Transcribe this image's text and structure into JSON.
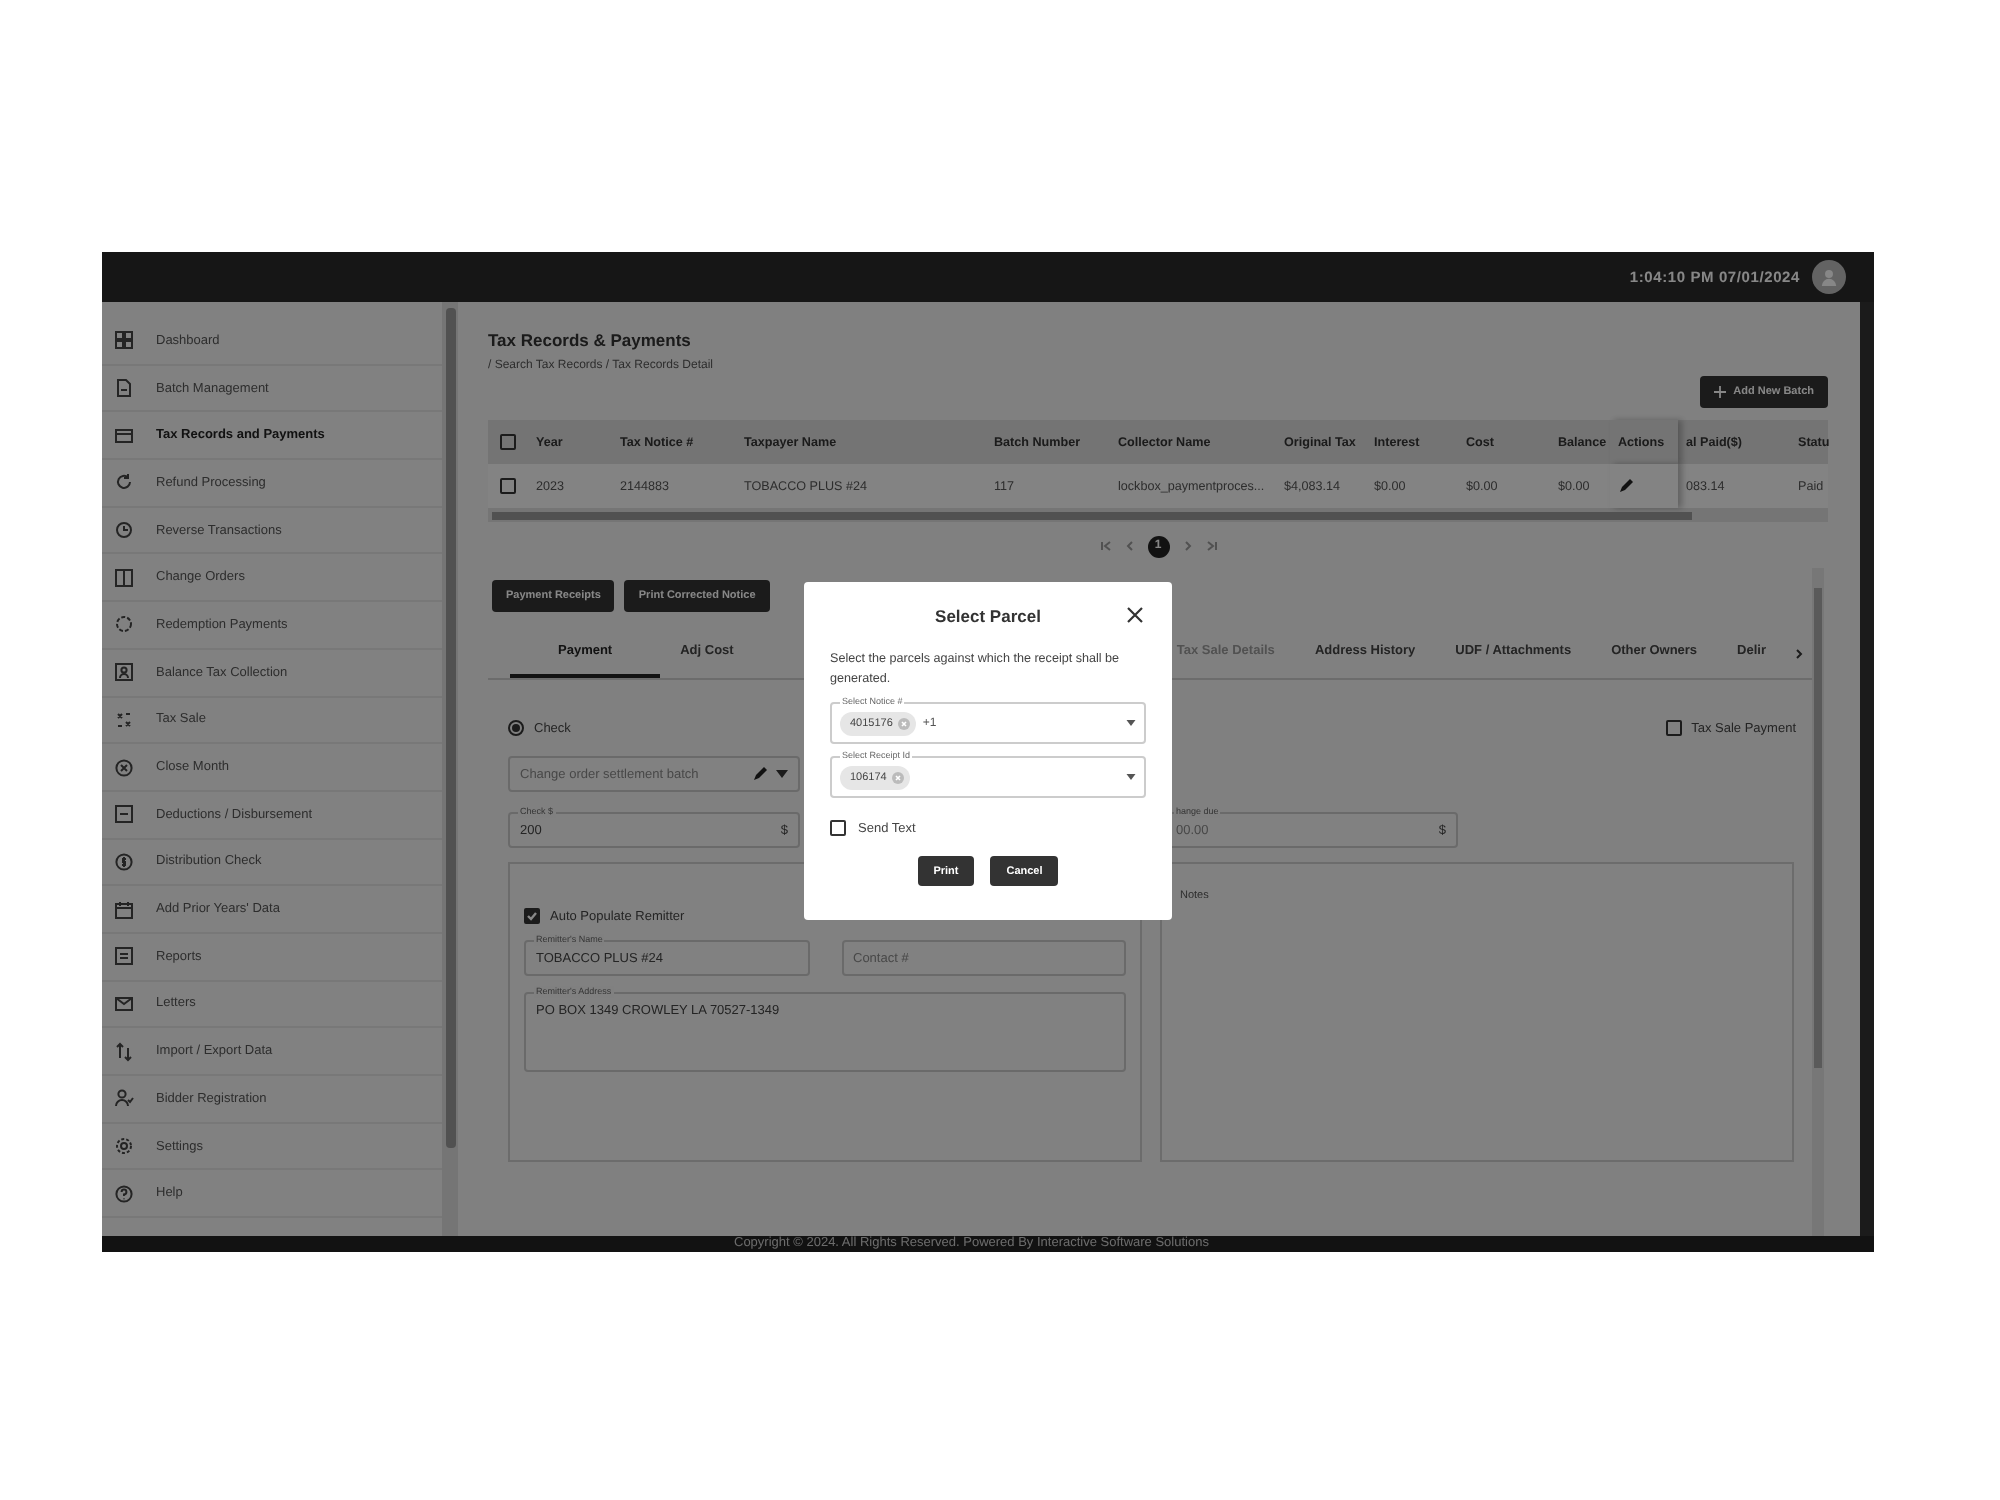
{
  "topbar": {
    "time": "1:04:10 PM 07/01/2024"
  },
  "sidebar": {
    "items": [
      {
        "label": "Dashboard",
        "selected": false
      },
      {
        "label": "Batch Management",
        "selected": false
      },
      {
        "label": "Tax Records and Payments",
        "selected": true
      },
      {
        "label": "Refund Processing",
        "selected": false
      },
      {
        "label": "Reverse Transactions",
        "selected": false
      },
      {
        "label": "Change Orders",
        "selected": false
      },
      {
        "label": "Redemption Payments",
        "selected": false
      },
      {
        "label": "Balance Tax Collection",
        "selected": false
      },
      {
        "label": "Tax Sale",
        "selected": false
      },
      {
        "label": "Close Month",
        "selected": false
      },
      {
        "label": "Deductions / Disbursement",
        "selected": false
      },
      {
        "label": "Distribution Check",
        "selected": false
      },
      {
        "label": "Add Prior Years' Data",
        "selected": false
      },
      {
        "label": "Reports",
        "selected": false
      },
      {
        "label": "Letters",
        "selected": false
      },
      {
        "label": "Import / Export Data",
        "selected": false
      },
      {
        "label": "Bidder Registration",
        "selected": false
      },
      {
        "label": "Settings",
        "selected": false
      },
      {
        "label": "Help",
        "selected": false
      }
    ]
  },
  "page": {
    "title": "Tax Records & Payments",
    "breadcrumb": "/ Search Tax Records / Tax Records Detail",
    "add_button": "Add New Batch"
  },
  "table": {
    "all_checked": false,
    "columns": [
      "Year",
      "Tax Notice #",
      "Taxpayer Name",
      "Batch Number",
      "Collector Name",
      "Original Tax",
      "Interest",
      "Cost",
      "Balance",
      "Actions",
      "al Paid($)",
      "Statu"
    ],
    "rows": [
      {
        "checked": false,
        "cells": [
          "2023",
          "2144883",
          "TOBACCO PLUS #24",
          "117",
          "lockbox_paymentproces...",
          "$4,083.14",
          "$0.00",
          "$0.00",
          "$0.00",
          "",
          "083.14",
          "Paid"
        ]
      }
    ]
  },
  "pagination": {
    "pages": [
      {
        "label": "1",
        "selected": true
      }
    ]
  },
  "actions": [
    "Payment Receipts",
    "Print Corrected Notice"
  ],
  "tabs": [
    {
      "label": "Payment",
      "selected": true,
      "disabled": false
    },
    {
      "label": "Adj Cost",
      "selected": false,
      "disabled": false
    },
    {
      "label": "Tax Sale Details",
      "selected": false,
      "disabled": true
    },
    {
      "label": "Address History",
      "selected": false,
      "disabled": false
    },
    {
      "label": "UDF / Attachments",
      "selected": false,
      "disabled": false
    },
    {
      "label": "Other Owners",
      "selected": false,
      "disabled": false
    },
    {
      "label": "Delir",
      "selected": false,
      "disabled": false
    }
  ],
  "payment": {
    "method": {
      "label": "Check",
      "selected": true
    },
    "tax_sale_payment": {
      "label": "Tax Sale Payment",
      "checked": false
    },
    "batch_field": {
      "placeholder": "Change order settlement batch"
    },
    "check_amount": {
      "label": "Check $",
      "value": "200",
      "adornment": "$"
    },
    "change_due": {
      "label": "hange due",
      "value": "00.00",
      "adornment": "$"
    },
    "remitter": {
      "auto_populate": {
        "label": "Auto Populate Remitter",
        "checked": true
      },
      "name": {
        "label": "Remitter's Name",
        "value": "TOBACCO PLUS #24"
      },
      "contact": {
        "placeholder": "Contact #"
      },
      "address": {
        "label": "Remitter's Address",
        "value": "PO BOX 1349 CROWLEY LA 70527-1349"
      }
    },
    "notes": {
      "label": "Notes"
    }
  },
  "footer": "Copyright © 2024. All Rights Reserved. Powered By Interactive Software Solutions",
  "dialog": {
    "title": "Select Parcel",
    "message": "Select the parcels against which the receipt shall be generated.",
    "notice_select": {
      "label": "Select Notice #",
      "chips": [
        "4015176"
      ],
      "more": "+1"
    },
    "receipt_select": {
      "label": "Select Receipt Id",
      "chips": [
        "106174"
      ]
    },
    "send_text": {
      "label": "Send Text",
      "checked": false
    },
    "buttons": [
      "Print",
      "Cancel"
    ]
  }
}
